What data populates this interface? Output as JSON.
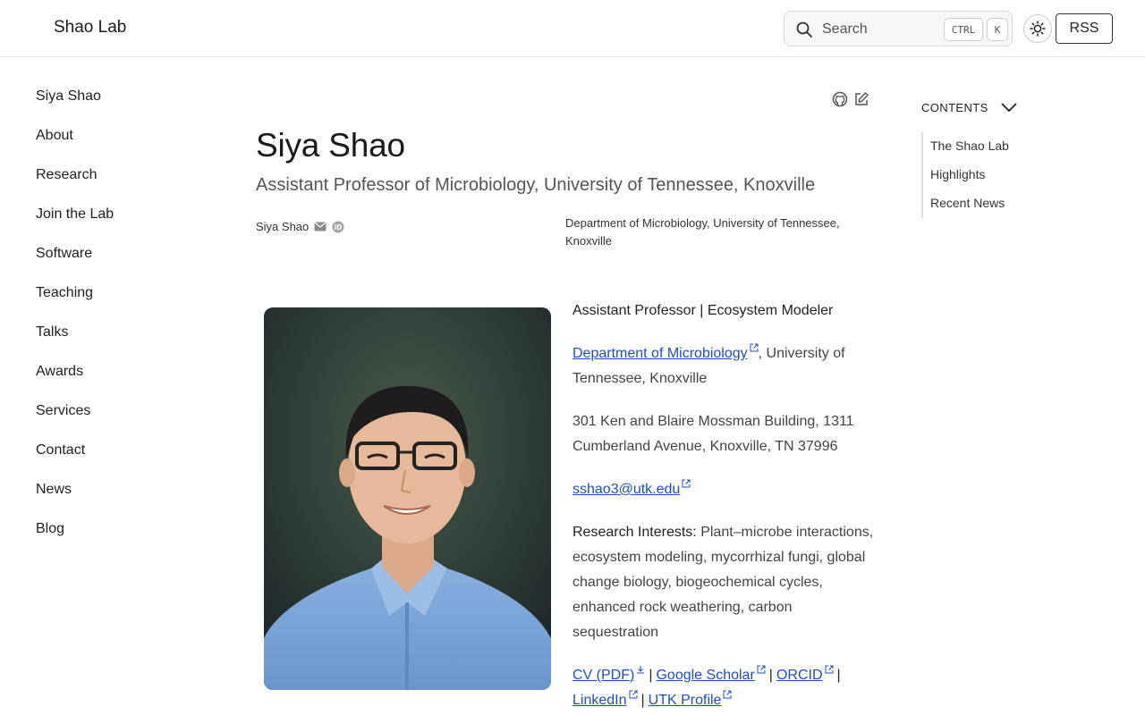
{
  "header": {
    "brand": "Shao Lab",
    "search_label": "Search",
    "kbd_ctrl": "CTRL",
    "kbd_k": "K",
    "rss_label": "RSS"
  },
  "sidebar": {
    "items": [
      {
        "label": "Siya Shao"
      },
      {
        "label": "About"
      },
      {
        "label": "Research"
      },
      {
        "label": "Join the Lab"
      },
      {
        "label": "Software"
      },
      {
        "label": "Teaching"
      },
      {
        "label": "Talks"
      },
      {
        "label": "Awards"
      },
      {
        "label": "Services"
      },
      {
        "label": "Contact"
      },
      {
        "label": "News"
      },
      {
        "label": "Blog"
      }
    ]
  },
  "page": {
    "title": "Siya Shao",
    "subtitle": "Assistant Professor of Microbiology, University of Tennessee, Knoxville",
    "author": "Siya Shao",
    "affiliation": "Department of Microbiology, University of Tennessee, Knoxville"
  },
  "profile": {
    "role": "Assistant Professor | Ecosystem Modeler",
    "dept_link": "Department of Microbiology",
    "dept_rest": ", University of Tennessee, Knoxville",
    "address": "301 Ken and Blaire Mossman Building, 1311 Cumberland Avenue, Knoxville, TN 37996",
    "email": "sshao3@utk.edu",
    "interests_label": "Research Interests:",
    "interests_text": "Plant–microbe interactions, ecosystem modeling, mycorrhizal fungi, global change biology, biogeochemical cycles, enhanced rock weathering, carbon sequestration",
    "links": {
      "cv": "CV (PDF)",
      "scholar": "Google Scholar",
      "orcid": "ORCID",
      "linkedin": "LinkedIn",
      "utk": "UTK Profile",
      "separator": "|"
    }
  },
  "toc": {
    "heading": "CONTENTS",
    "items": [
      {
        "label": "The Shao Lab"
      },
      {
        "label": "Highlights"
      },
      {
        "label": "Recent News"
      }
    ]
  },
  "colors": {
    "link": "#1f4fb8",
    "text": "#222222",
    "border": "#e3e3e3"
  },
  "icons": [
    "search-icon",
    "sun-icon",
    "github-icon",
    "edit-icon",
    "envelope-icon",
    "orcid-icon",
    "chevron-down-icon",
    "external-link-icon",
    "download-icon"
  ]
}
